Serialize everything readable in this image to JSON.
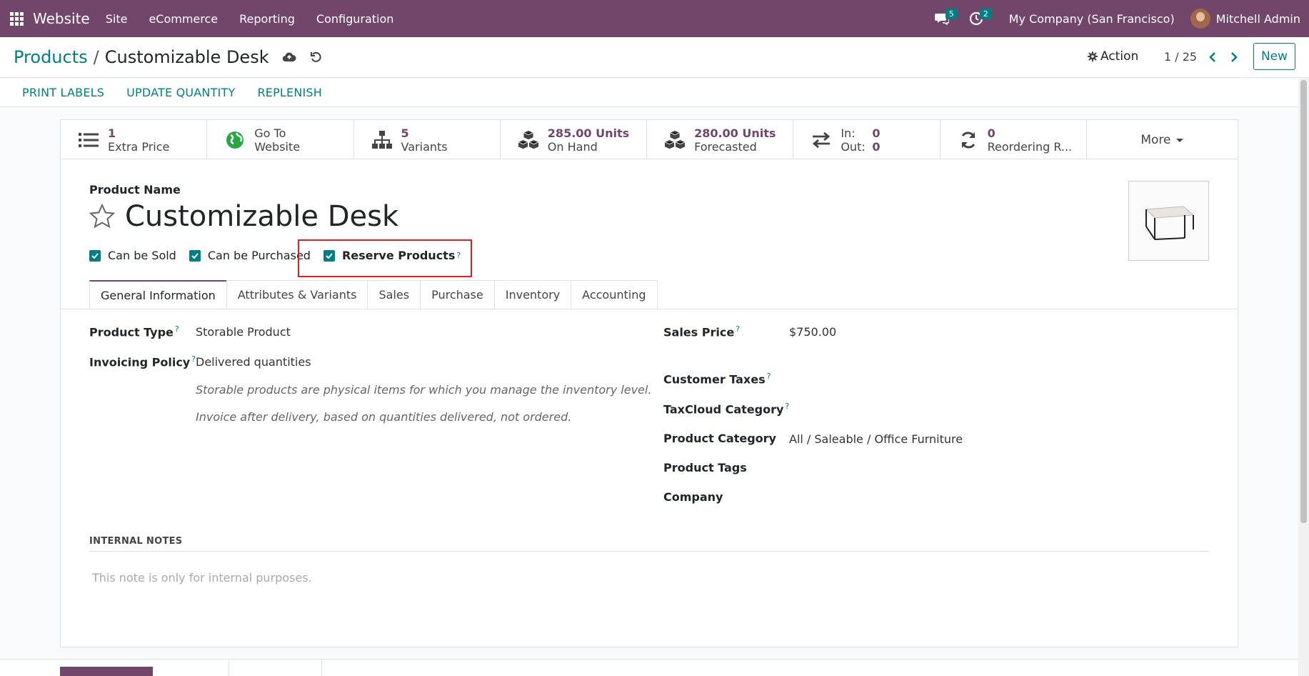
{
  "topnav": {
    "app_name": "Website",
    "menu": [
      "Site",
      "eCommerce",
      "Reporting",
      "Configuration"
    ],
    "messages_count": "5",
    "activities_count": "2",
    "company": "My Company (San Francisco)",
    "user": "Mitchell Admin"
  },
  "breadcrumb": {
    "parent": "Products",
    "separator": "/",
    "current": "Customizable Desk"
  },
  "control": {
    "action_label": "Action",
    "pager": "1 / 25",
    "new_label": "New"
  },
  "statusbar": {
    "buttons": [
      "PRINT LABELS",
      "UPDATE QUANTITY",
      "REPLENISH"
    ]
  },
  "smart_buttons": {
    "extra_price": {
      "value": "1",
      "label": "Extra Price"
    },
    "website": {
      "line1": "Go To",
      "line2": "Website"
    },
    "variants": {
      "value": "5",
      "label": "Variants"
    },
    "on_hand": {
      "value": "285.00 Units",
      "label": "On Hand"
    },
    "forecasted": {
      "value": "280.00 Units",
      "label": "Forecasted"
    },
    "in_out": {
      "in_label": "In:",
      "in_value": "0",
      "out_label": "Out:",
      "out_value": "0"
    },
    "reordering": {
      "value": "0",
      "label": "Reordering R..."
    },
    "more": "More"
  },
  "form": {
    "product_name_label": "Product Name",
    "product_name": "Customizable Desk",
    "checkboxes": [
      {
        "label": "Can be Sold",
        "checked": true
      },
      {
        "label": "Can be Purchased",
        "checked": true
      },
      {
        "label": "Reserve Products",
        "checked": true
      }
    ],
    "help_mark": "?",
    "tabs": [
      "General Information",
      "Attributes & Variants",
      "Sales",
      "Purchase",
      "Inventory",
      "Accounting"
    ],
    "left_fields": {
      "product_type_label": "Product Type",
      "product_type": "Storable Product",
      "invoicing_policy_label": "Invoicing Policy",
      "invoicing_policy": "Delivered quantities",
      "help1": "Storable products are physical items for which you manage the inventory level.",
      "help2": "Invoice after delivery, based on quantities delivered, not ordered."
    },
    "right_fields": {
      "sales_price_label": "Sales Price",
      "sales_price": "$750.00",
      "customer_taxes_label": "Customer Taxes",
      "taxcloud_label": "TaxCloud Category",
      "category_label": "Product Category",
      "category": "All / Saleable / Office Furniture",
      "tags_label": "Product Tags",
      "company_label": "Company"
    },
    "notes_title": "INTERNAL NOTES",
    "notes_placeholder": "This note is only for internal purposes."
  },
  "colors": {
    "brand": "#71466a",
    "accent": "#017e84",
    "highlight": "#e02020"
  }
}
